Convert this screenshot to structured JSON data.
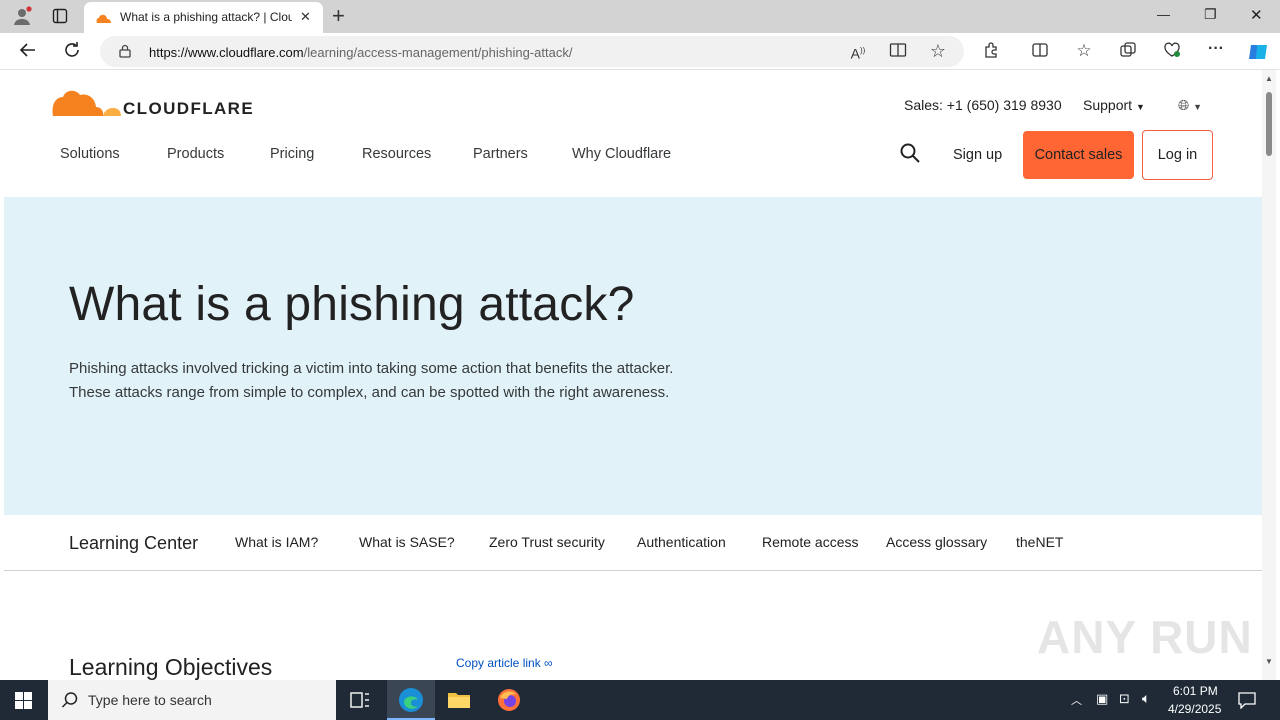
{
  "browser": {
    "tab_title": "What is a phishing attack? | Cloudflare",
    "new_tab_symbol": "+",
    "close_tab_symbol": "✕",
    "url_host": "https://www.cloudflare.com",
    "url_path": "/learning/access-management/phishing-attack/",
    "window_min": "—",
    "window_restore": "❐",
    "window_close": "✕"
  },
  "header": {
    "logo_text": "CLOUDFLARE",
    "sales": "Sales: +1 (650) 319 8930",
    "support": "Support",
    "nav": [
      "Solutions",
      "Products",
      "Pricing",
      "Resources",
      "Partners",
      "Why Cloudflare"
    ],
    "sign_up": "Sign up",
    "contact_sales": "Contact sales",
    "log_in": "Log in"
  },
  "hero": {
    "title": "What is a phishing attack?",
    "desc_line1": "Phishing attacks involved tricking a victim into taking some action that benefits the attacker.",
    "desc_line2": "These attacks range from simple to complex, and can be spotted with the right awareness."
  },
  "subnav": {
    "title": "Learning Center",
    "items": [
      "What is IAM?",
      "What is SASE?",
      "Zero Trust security",
      "Authentication",
      "Remote access",
      "Access glossary",
      "theNET"
    ]
  },
  "content": {
    "objectives_title": "Learning Objectives",
    "copy_link": "Copy article link"
  },
  "watermark": "ANY RUN",
  "taskbar": {
    "search_placeholder": "Type here to search",
    "time": "6:01 PM",
    "date": "4/29/2025"
  },
  "colors": {
    "accent": "#f6821f",
    "contact_button": "#ff6633",
    "hero_bg": "#e1f2f9",
    "taskbar": "#1f2a36"
  }
}
